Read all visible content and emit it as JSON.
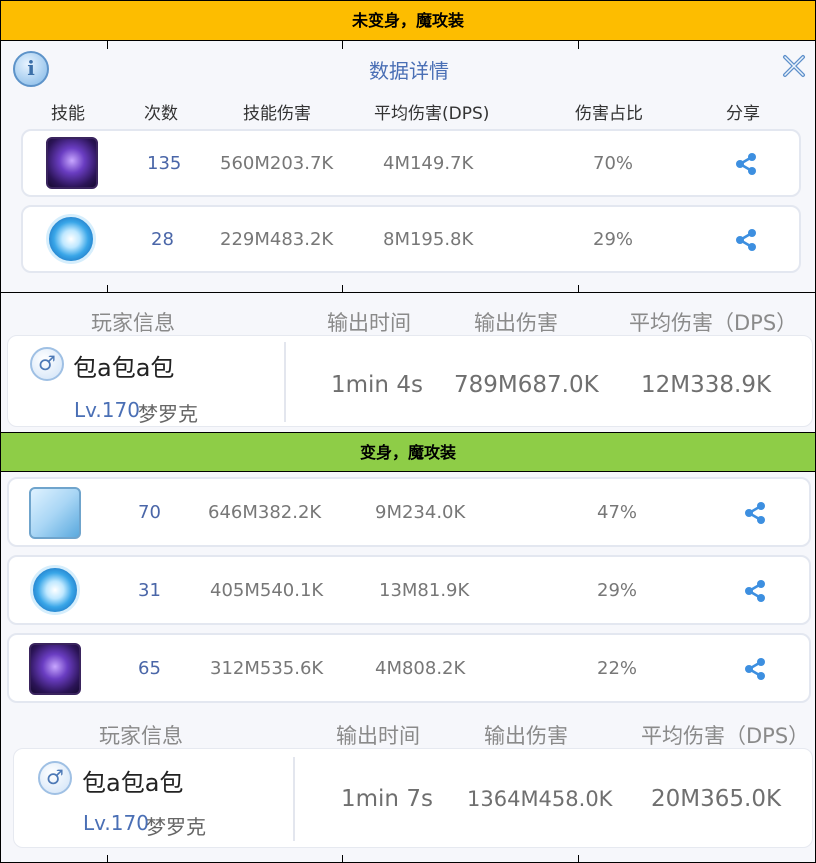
{
  "banners": {
    "top": "未变身，魔攻装",
    "middle": "变身，魔攻装"
  },
  "panel": {
    "title": "数据详情",
    "info_icon": "info-icon",
    "close_icon": "close-icon",
    "headers": [
      "技能",
      "次数",
      "技能伤害",
      "平均伤害(DPS)",
      "伤害占比",
      "分享"
    ]
  },
  "section1": {
    "rows": [
      {
        "icon": "purple-burst-skill-icon",
        "count": "135",
        "damage": "560M203.7K",
        "dps": "4M149.7K",
        "ratio": "70%"
      },
      {
        "icon": "blue-orb-skill-icon",
        "count": "28",
        "damage": "229M483.2K",
        "dps": "8M195.8K",
        "ratio": "29%"
      }
    ],
    "player": {
      "headers": [
        "玩家信息",
        "输出时间",
        "输出伤害",
        "平均伤害（DPS）"
      ],
      "gender_symbol": "♂",
      "name": "包a包a包",
      "level": "Lv.170",
      "job": "梦罗克",
      "time": "1min 4s",
      "total_damage": "789M687.0K",
      "dps": "12M338.9K"
    }
  },
  "section2": {
    "rows": [
      {
        "icon": "sword-skill-icon",
        "count": "70",
        "damage": "646M382.2K",
        "dps": "9M234.0K",
        "ratio": "47%"
      },
      {
        "icon": "blue-orb-skill-icon",
        "count": "31",
        "damage": "405M540.1K",
        "dps": "13M81.9K",
        "ratio": "29%"
      },
      {
        "icon": "purple-burst-skill-icon",
        "count": "65",
        "damage": "312M535.6K",
        "dps": "4M808.2K",
        "ratio": "22%"
      }
    ],
    "player": {
      "headers": [
        "玩家信息",
        "输出时间",
        "输出伤害",
        "平均伤害（DPS）"
      ],
      "gender_symbol": "♂",
      "name": "包a包a包",
      "level": "Lv.170",
      "job": "梦罗克",
      "time": "1min 7s",
      "total_damage": "1364M458.0K",
      "dps": "20M365.0K"
    }
  },
  "colors": {
    "banner_top": "#fdbd00",
    "banner_middle": "#8ecd47",
    "accent_blue": "#4a6fb5",
    "share_blue": "#3d8fe0"
  }
}
